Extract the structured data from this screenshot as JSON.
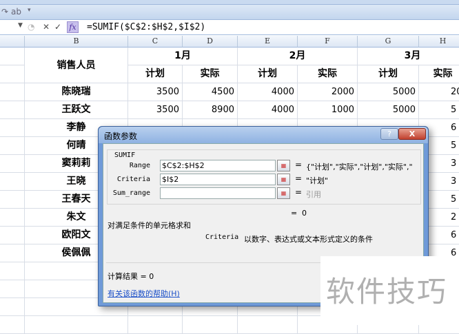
{
  "qat": {
    "icons": [
      "redo-icon",
      "format-icon",
      "customize-qat-icon"
    ]
  },
  "formula_bar": {
    "formula": "=SUMIF($C$2:$H$2,$I$2)",
    "fx": "fx"
  },
  "columns": [
    "B",
    "C",
    "D",
    "E",
    "F",
    "G",
    "H"
  ],
  "header": {
    "salesperson": "销售人员",
    "months": [
      "1月",
      "2月",
      "3月"
    ],
    "plan": "计划",
    "actual": "实际"
  },
  "rows": [
    {
      "name": "陈晓瑞",
      "values": [
        "3500",
        "4500",
        "4000",
        "2000",
        "5000",
        "20"
      ]
    },
    {
      "name": "王跃文",
      "values": [
        "3500",
        "8900",
        "4000",
        "1000",
        "5000",
        "5"
      ]
    },
    {
      "name": "李静",
      "values": [
        "",
        "",
        "",
        "",
        "",
        "6"
      ]
    },
    {
      "name": "何晴",
      "values": [
        "",
        "",
        "",
        "",
        "",
        "5"
      ]
    },
    {
      "name": "窦莉莉",
      "values": [
        "",
        "",
        "",
        "",
        "",
        "3"
      ]
    },
    {
      "name": "王晓",
      "values": [
        "",
        "",
        "",
        "",
        "",
        "3"
      ]
    },
    {
      "name": "王春天",
      "values": [
        "",
        "",
        "",
        "",
        "",
        "5"
      ]
    },
    {
      "name": "朱文",
      "values": [
        "",
        "",
        "",
        "",
        "",
        "2"
      ]
    },
    {
      "name": "欧阳文",
      "values": [
        "",
        "",
        "",
        "",
        "",
        "6"
      ]
    },
    {
      "name": "侯佩佩",
      "values": [
        "",
        "",
        "",
        "",
        "",
        "6"
      ]
    }
  ],
  "dialog": {
    "title": "函数参数",
    "help": "?",
    "close": "X",
    "function": "SUMIF",
    "args": [
      {
        "label": "Range",
        "value": "$C$2:$H$2",
        "result": "{\"计划\",\"实际\",\"计划\",\"实际\",\""
      },
      {
        "label": "Criteria",
        "value": "$I$2",
        "result": "\"计划\""
      },
      {
        "label": "Sum_range",
        "value": "",
        "result": "引用"
      }
    ],
    "eq": "=",
    "formula_result": "0",
    "description": "对满足条件的单元格求和",
    "arg_help_name": "Criteria",
    "arg_help": "以数字、表达式或文本形式定义的条件",
    "calc_result": "计算结果 =  0",
    "help_link": "有关该函数的帮助(H)"
  },
  "watermark": "软件技巧"
}
